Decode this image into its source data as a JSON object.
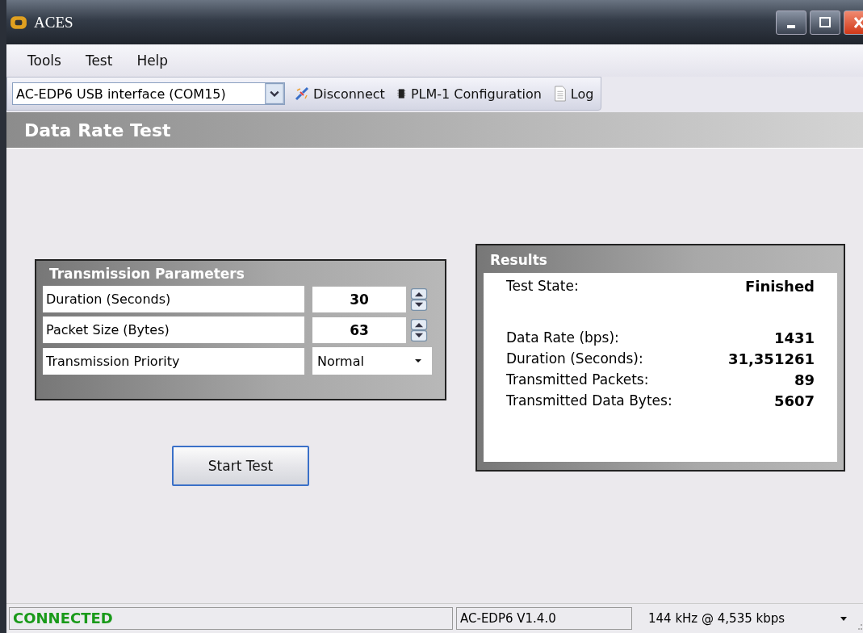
{
  "window": {
    "title": "ACES"
  },
  "menu": [
    "Tools",
    "Test",
    "Help"
  ],
  "toolbar": {
    "port": "AC-EDP6 USB interface (COM15)",
    "buttons": [
      {
        "kind": "disconnect",
        "label": "Disconnect"
      },
      {
        "kind": "chip",
        "label": "PLM-1 Configuration"
      },
      {
        "kind": "log",
        "label": "Log"
      }
    ]
  },
  "page_title": "Data Rate Test",
  "parameters": {
    "title": "Transmission Parameters",
    "rows": [
      {
        "kind": "spin",
        "label": "Duration (Seconds)",
        "value": "30"
      },
      {
        "kind": "spin",
        "label": "Packet Size (Bytes)",
        "value": "63"
      },
      {
        "kind": "dropdown",
        "label": "Transmission Priority",
        "value": "Normal"
      }
    ]
  },
  "start_button": "Start Test",
  "results": {
    "title": "Results",
    "state": {
      "label": "Test State:",
      "value": "Finished"
    },
    "rows": [
      {
        "label": "Data Rate (bps):",
        "value": "1431"
      },
      {
        "label": "Duration (Seconds):",
        "value": "31,351261"
      },
      {
        "label": "Transmitted Packets:",
        "value": "89"
      },
      {
        "label": "Transmitted Data Bytes:",
        "value": "5607"
      }
    ]
  },
  "status_bar": {
    "connection": "CONNECTED",
    "version": "AC-EDP6 V1.4.0",
    "rate": "144 kHz @ 4,535 kbps"
  }
}
